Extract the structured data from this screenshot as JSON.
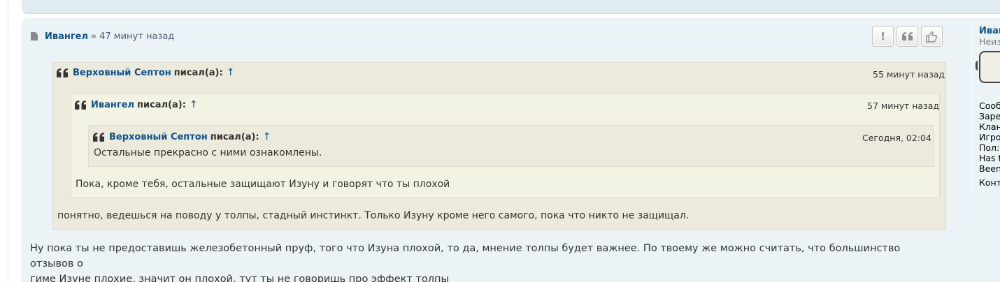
{
  "post": {
    "author": "Ивангел",
    "separator": "»",
    "time": "47 минут назад",
    "buttons": {
      "report": "!",
      "quote_icon": "quote-icon",
      "like_icon": "thumbs-up-icon"
    }
  },
  "quotes": [
    {
      "author": "Верховный Септон",
      "wrote": "писал(а):",
      "arrow": "↑",
      "date": "55 минут назад",
      "text": "понятно, ведешься на поводу у толпы, стадный инстинкт. Только Изуну кроме него самого, пока что никто не защищал."
    },
    {
      "author": "Ивангел",
      "wrote": "писал(а):",
      "arrow": "↑",
      "date": "57 минут назад",
      "text": "Пока, кроме тебя, остальные защищают Изуну и говорят что ты плохой"
    },
    {
      "author": "Верховный Септон",
      "wrote": "писал(а):",
      "arrow": "↑",
      "date": "Сегодня, 02:04",
      "text": "Остальные прекрасно с ними ознакомлены."
    }
  ],
  "body": {
    "line1": "Ну пока ты не предоставишь железобетонный пруф, того что Изуна плохой, то да, мнение толпы будет важнее. По твоему же можно считать, что большинство отзывов о",
    "line2": "гиме Изуне плохие, значит он плохой, тут ты не говоришь про эффект толпы"
  },
  "profile": {
    "name": "Иван",
    "rank": "Неиз",
    "fields": [
      "Сооб",
      "Заре",
      "Клан",
      "Игро",
      "Пол:",
      "Has t",
      "Been"
    ],
    "contact": "Конт"
  },
  "colors": {
    "link": "#105289",
    "quote_bg": "#ebeadd",
    "quote_bg_alt": "#f3f3e3",
    "post_bg": "#ecf3f7"
  }
}
